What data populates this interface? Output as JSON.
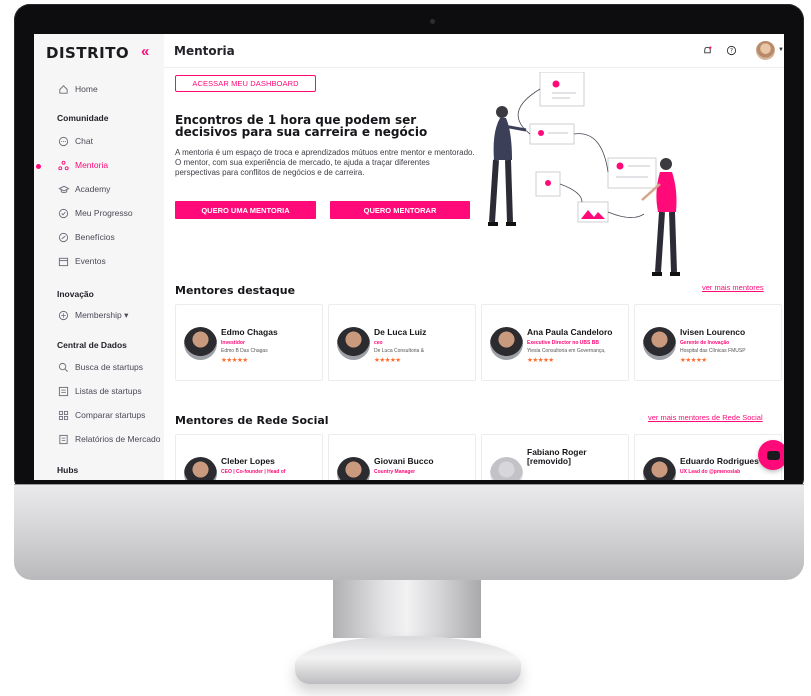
{
  "sidebar": {
    "logo": "DISTRITO",
    "collapse_icon": "«",
    "items": [
      {
        "label": "Home",
        "icon": "home-icon"
      },
      {
        "label": "Chat",
        "icon": "chat-icon"
      },
      {
        "label": "Mentoria",
        "icon": "mentoria-icon"
      },
      {
        "label": "Academy",
        "icon": "graduation-cap-icon"
      },
      {
        "label": "Meu Progresso",
        "icon": "check-circle-icon"
      },
      {
        "label": "Benefícios",
        "icon": "badge-icon"
      },
      {
        "label": "Eventos",
        "icon": "calendar-icon"
      },
      {
        "label": "Membership ▾",
        "icon": "membership-icon"
      },
      {
        "label": "Busca de startups",
        "icon": "search-icon"
      },
      {
        "label": "Listas de startups",
        "icon": "list-icon"
      },
      {
        "label": "Comparar startups",
        "icon": "compare-icon"
      },
      {
        "label": "Relatórios de Mercado",
        "icon": "report-icon"
      }
    ],
    "sections": {
      "comunidade": "Comunidade",
      "inovacao": "Inovação",
      "central": "Central de Dados",
      "hubs": "Hubs"
    }
  },
  "header": {
    "title": "Mentoria"
  },
  "hero": {
    "dashboard_button": "ACESSAR MEU DASHBOARD",
    "title": "Encontros de 1 hora que podem ser decisivos para sua carreira e negócio",
    "text": "A mentoria é um espaço de troca e aprendizados mútuos entre mentor e mentorado. O mentor, com sua experiência de mercado, te ajuda a traçar diferentes perspectivas para conflitos de negócios e de carreira.",
    "primary_button": "QUERO UMA MENTORIA",
    "secondary_button": "QUERO MENTORAR"
  },
  "featured": {
    "title": "Mentores destaque",
    "link": "ver mais mentores",
    "mentors": [
      {
        "name": "Edmo Chagas",
        "role": "Investidor",
        "org": "Edmo B Das Chagas",
        "stars": "★★★★★"
      },
      {
        "name": "De Luca Luiz",
        "role": "ceo",
        "org": "De Luca Consultoria &",
        "stars": "★★★★★"
      },
      {
        "name": "Ana Paula Candeloro",
        "role": "Executive Director no UBS BB",
        "org": "Yiesia Consultoria em Governança,",
        "stars": "★★★★★"
      },
      {
        "name": "Ivisen Lourenco",
        "role": "Gerente de Inovação",
        "org": "Hospital das Clínicas FMUSP",
        "stars": "★★★★★"
      }
    ]
  },
  "social": {
    "title": "Mentores de Rede Social",
    "link": "ver mais mentores de Rede Social",
    "mentors": [
      {
        "name": "Cleber Lopes",
        "role": "CEO | Co-founder | Head of"
      },
      {
        "name": "Giovani Bucco",
        "role": "Country Manager"
      },
      {
        "name": "Fabiano Roger [removido]",
        "role": ""
      },
      {
        "name": "Eduardo Rodrigues",
        "role": "UX Lead do @pmenoslab"
      }
    ]
  },
  "colors": {
    "accent": "#ff0a78",
    "sidebar_bg": "#f6f6f7",
    "stars": "#ff6b2c"
  }
}
